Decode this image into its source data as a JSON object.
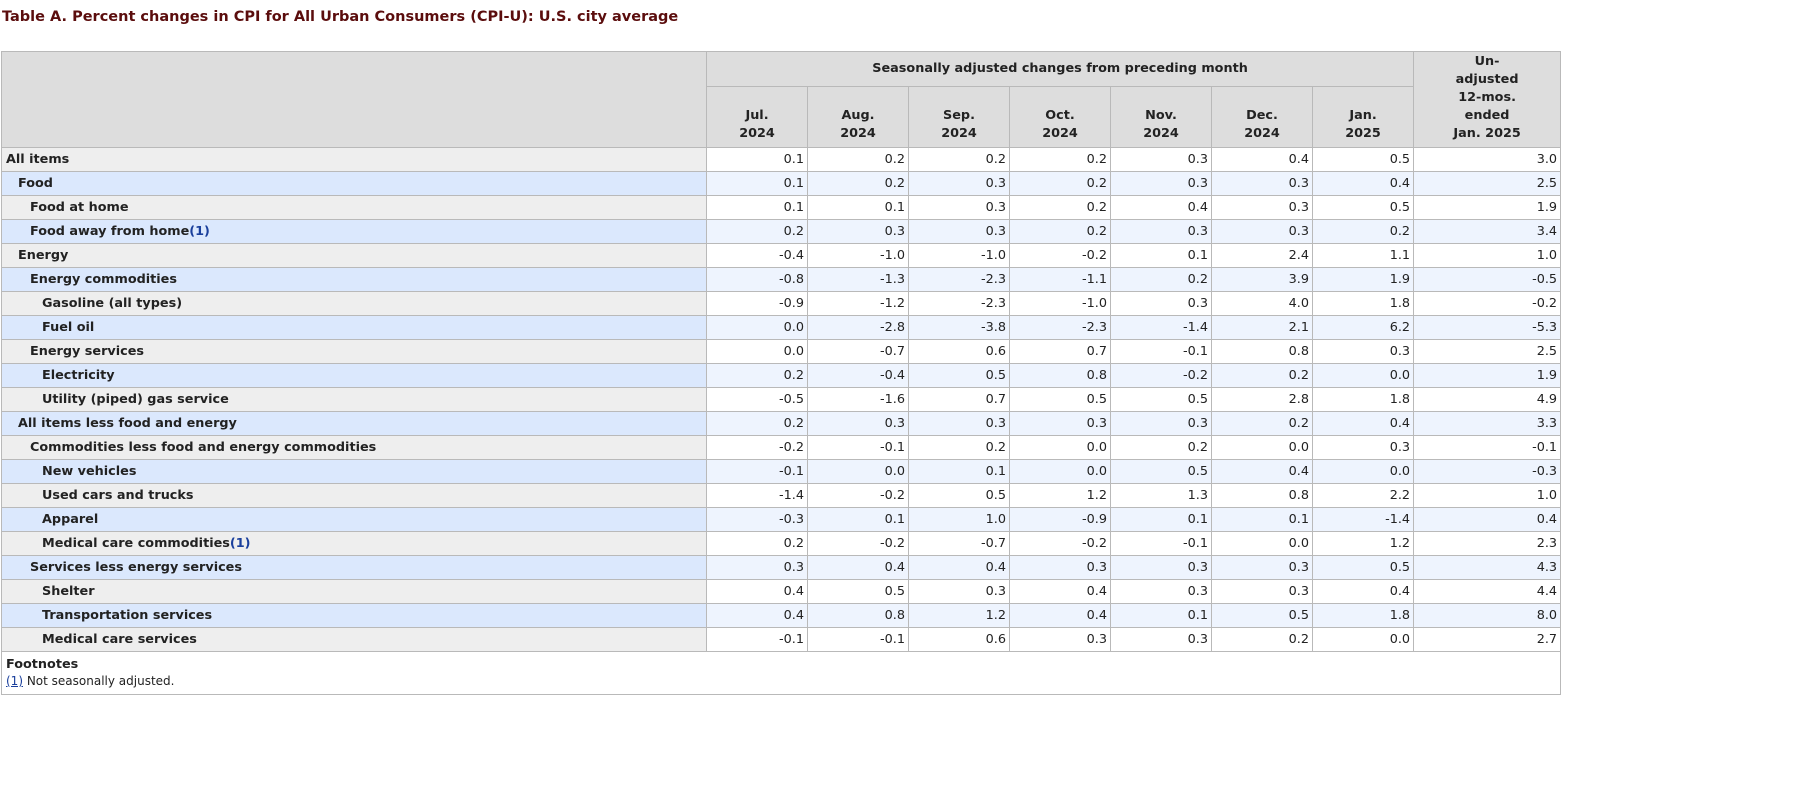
{
  "title": "Table A. Percent changes in CPI for All Urban Consumers (CPI-U): U.S. city average",
  "header": {
    "group_label": "Seasonally adjusted changes from preceding month",
    "months": [
      {
        "month": "Jul.",
        "year": "2024"
      },
      {
        "month": "Aug.",
        "year": "2024"
      },
      {
        "month": "Sep.",
        "year": "2024"
      },
      {
        "month": "Oct.",
        "year": "2024"
      },
      {
        "month": "Nov.",
        "year": "2024"
      },
      {
        "month": "Dec.",
        "year": "2024"
      },
      {
        "month": "Jan.",
        "year": "2025"
      }
    ],
    "unadjusted_lines": [
      "Un-",
      "adjusted",
      "12-mos.",
      "ended",
      "Jan. 2025"
    ]
  },
  "rows": [
    {
      "label": "All items",
      "level": 0,
      "footnote": "",
      "values": [
        "0.1",
        "0.2",
        "0.2",
        "0.2",
        "0.3",
        "0.4",
        "0.5",
        "3.0"
      ]
    },
    {
      "label": "Food",
      "level": 1,
      "footnote": "",
      "values": [
        "0.1",
        "0.2",
        "0.3",
        "0.2",
        "0.3",
        "0.3",
        "0.4",
        "2.5"
      ]
    },
    {
      "label": "Food at home",
      "level": 2,
      "footnote": "",
      "values": [
        "0.1",
        "0.1",
        "0.3",
        "0.2",
        "0.4",
        "0.3",
        "0.5",
        "1.9"
      ]
    },
    {
      "label": "Food away from home",
      "level": 2,
      "footnote": "(1)",
      "values": [
        "0.2",
        "0.3",
        "0.3",
        "0.2",
        "0.3",
        "0.3",
        "0.2",
        "3.4"
      ]
    },
    {
      "label": "Energy",
      "level": 1,
      "footnote": "",
      "values": [
        "-0.4",
        "-1.0",
        "-1.0",
        "-0.2",
        "0.1",
        "2.4",
        "1.1",
        "1.0"
      ]
    },
    {
      "label": "Energy commodities",
      "level": 2,
      "footnote": "",
      "values": [
        "-0.8",
        "-1.3",
        "-2.3",
        "-1.1",
        "0.2",
        "3.9",
        "1.9",
        "-0.5"
      ]
    },
    {
      "label": "Gasoline (all types)",
      "level": 3,
      "footnote": "",
      "values": [
        "-0.9",
        "-1.2",
        "-2.3",
        "-1.0",
        "0.3",
        "4.0",
        "1.8",
        "-0.2"
      ]
    },
    {
      "label": "Fuel oil",
      "level": 3,
      "footnote": "",
      "values": [
        "0.0",
        "-2.8",
        "-3.8",
        "-2.3",
        "-1.4",
        "2.1",
        "6.2",
        "-5.3"
      ]
    },
    {
      "label": "Energy services",
      "level": 2,
      "footnote": "",
      "values": [
        "0.0",
        "-0.7",
        "0.6",
        "0.7",
        "-0.1",
        "0.8",
        "0.3",
        "2.5"
      ]
    },
    {
      "label": "Electricity",
      "level": 3,
      "footnote": "",
      "values": [
        "0.2",
        "-0.4",
        "0.5",
        "0.8",
        "-0.2",
        "0.2",
        "0.0",
        "1.9"
      ]
    },
    {
      "label": "Utility (piped) gas service",
      "level": 3,
      "footnote": "",
      "values": [
        "-0.5",
        "-1.6",
        "0.7",
        "0.5",
        "0.5",
        "2.8",
        "1.8",
        "4.9"
      ]
    },
    {
      "label": "All items less food and energy",
      "level": 1,
      "footnote": "",
      "values": [
        "0.2",
        "0.3",
        "0.3",
        "0.3",
        "0.3",
        "0.2",
        "0.4",
        "3.3"
      ]
    },
    {
      "label": "Commodities less food and energy commodities",
      "level": 2,
      "footnote": "",
      "values": [
        "-0.2",
        "-0.1",
        "0.2",
        "0.0",
        "0.2",
        "0.0",
        "0.3",
        "-0.1"
      ]
    },
    {
      "label": "New vehicles",
      "level": 3,
      "footnote": "",
      "values": [
        "-0.1",
        "0.0",
        "0.1",
        "0.0",
        "0.5",
        "0.4",
        "0.0",
        "-0.3"
      ]
    },
    {
      "label": "Used cars and trucks",
      "level": 3,
      "footnote": "",
      "values": [
        "-1.4",
        "-0.2",
        "0.5",
        "1.2",
        "1.3",
        "0.8",
        "2.2",
        "1.0"
      ]
    },
    {
      "label": "Apparel",
      "level": 3,
      "footnote": "",
      "values": [
        "-0.3",
        "0.1",
        "1.0",
        "-0.9",
        "0.1",
        "0.1",
        "-1.4",
        "0.4"
      ]
    },
    {
      "label": "Medical care commodities",
      "level": 3,
      "footnote": "(1)",
      "values": [
        "0.2",
        "-0.2",
        "-0.7",
        "-0.2",
        "-0.1",
        "0.0",
        "1.2",
        "2.3"
      ]
    },
    {
      "label": "Services less energy services",
      "level": 2,
      "footnote": "",
      "values": [
        "0.3",
        "0.4",
        "0.4",
        "0.3",
        "0.3",
        "0.3",
        "0.5",
        "4.3"
      ]
    },
    {
      "label": "Shelter",
      "level": 3,
      "footnote": "",
      "values": [
        "0.4",
        "0.5",
        "0.3",
        "0.4",
        "0.3",
        "0.3",
        "0.4",
        "4.4"
      ]
    },
    {
      "label": "Transportation services",
      "level": 3,
      "footnote": "",
      "values": [
        "0.4",
        "0.8",
        "1.2",
        "0.4",
        "0.1",
        "0.5",
        "1.8",
        "8.0"
      ]
    },
    {
      "label": "Medical care services",
      "level": 3,
      "footnote": "",
      "values": [
        "-0.1",
        "-0.1",
        "0.6",
        "0.3",
        "0.3",
        "0.2",
        "0.0",
        "2.7"
      ]
    }
  ],
  "footnotes": {
    "heading": "Footnotes",
    "items": [
      {
        "ref": "(1)",
        "text": " Not seasonally adjusted."
      }
    ]
  }
}
